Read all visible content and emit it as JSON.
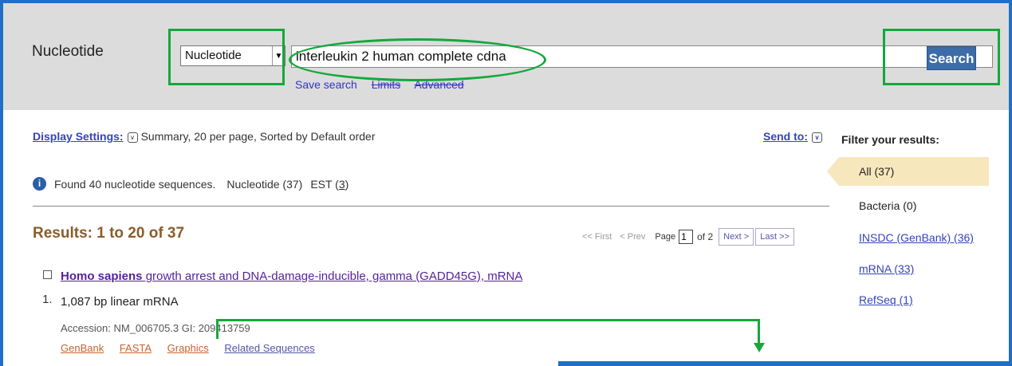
{
  "header": {
    "db_name": "Nucleotide",
    "db_select_value": "Nucleotide",
    "search_term": "interleukin 2 human complete cdna",
    "search_button": "Search",
    "links": [
      "Save search",
      "Limits",
      "Advanced"
    ]
  },
  "display": {
    "settings_label": "Display Settings:",
    "settings_value": "Summary, 20 per page, Sorted by Default order",
    "send_to": "Send to:"
  },
  "found": {
    "text": "Found 40 nucleotide sequences.",
    "nucleotide": "Nucleotide (37)",
    "est_label": "EST (",
    "est_count": "3",
    "est_close": ")"
  },
  "results": {
    "heading": "Results: 1 to 20 of 37",
    "pager": {
      "first": "<< First",
      "prev": "< Prev",
      "page_label": "Page",
      "page_value": "1",
      "of": "of 2",
      "next": "Next >",
      "last": "Last >>"
    },
    "items": [
      {
        "number": "1.",
        "title_bold": "Homo sapiens",
        "title_rest": " growth arrest and DNA-damage-inducible, gamma (GADD45G), mRNA",
        "desc": "1,087 bp linear mRNA",
        "accession": "Accession: NM_006705.3  GI: 209413759",
        "links": [
          "GenBank",
          "FASTA",
          "Graphics",
          "Related Sequences"
        ]
      }
    ]
  },
  "filter": {
    "heading": "Filter your results:",
    "items": [
      "All (37)",
      "Bacteria (0)",
      "INSDC (GenBank) (36)",
      "mRNA (33)",
      "RefSeq (1)"
    ]
  },
  "colors": {
    "frame": "#1f6fc6",
    "annotation": "#14a83c",
    "search_button": "#3c6da8",
    "results_heading": "#8a5d29"
  }
}
